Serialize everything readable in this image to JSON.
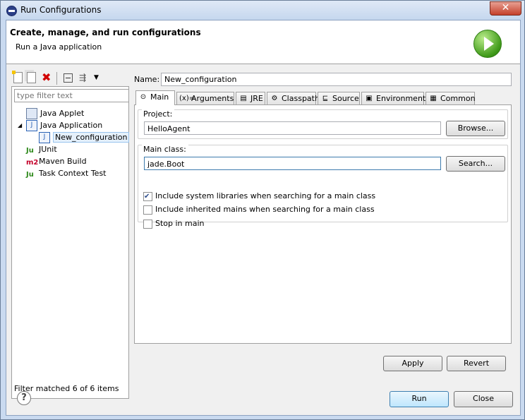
{
  "window": {
    "title": "Run Configurations",
    "close_glyph": "✕"
  },
  "header": {
    "title": "Create, manage, and run configurations",
    "subtitle": "Run a Java application"
  },
  "toolbar": {
    "delete_glyph": "✖",
    "filter_glyph": "⇶",
    "dropdown_glyph": "▼"
  },
  "filter": {
    "placeholder": "type filter text",
    "status": "Filter matched 6 of 6 items"
  },
  "tree": {
    "java_applet": {
      "label": "Java Applet"
    },
    "java_application": {
      "label": "Java Application",
      "expanded_glyph": "◢"
    },
    "new_configuration": {
      "label": "New_configuration"
    },
    "junit": {
      "label": "JUnit",
      "badge": "Ju"
    },
    "maven_build": {
      "label": "Maven Build",
      "badge": "m2"
    },
    "task_context_test": {
      "label": "Task Context Test",
      "badge": "Ju"
    }
  },
  "name": {
    "label": "Name:",
    "value": "New_configuration"
  },
  "tabs": {
    "main": {
      "label": "Main",
      "glyph": "⊙"
    },
    "arguments": {
      "label": "Arguments",
      "glyph": "(x)="
    },
    "jre": {
      "label": "JRE",
      "glyph": "▤"
    },
    "classpath": {
      "label": "Classpath",
      "glyph": "⚙"
    },
    "source": {
      "label": "Source",
      "glyph": "⊑"
    },
    "environment": {
      "label": "Environment",
      "glyph": "▣"
    },
    "common": {
      "label": "Common",
      "glyph": "▦"
    }
  },
  "main": {
    "project": {
      "label": "Project:",
      "value": "HelloAgent",
      "browse": "Browse..."
    },
    "main_class": {
      "label": "Main class:",
      "value": "jade.Boot",
      "search": "Search..."
    },
    "options": {
      "include_system": {
        "label": "Include system libraries when searching for a main class",
        "checked": true
      },
      "include_inherited": {
        "label": "Include inherited mains when searching for a main class",
        "checked": false
      },
      "stop_in_main": {
        "label": "Stop in main",
        "checked": false
      }
    }
  },
  "buttons": {
    "apply": "Apply",
    "revert": "Revert",
    "run": "Run",
    "close": "Close",
    "help_glyph": "?"
  },
  "colors": {
    "accent": "#3c7fb1",
    "run_green": "#3f9a19",
    "delete_red": "#d10000",
    "junit_green": "#2f8a1c",
    "maven_red": "#c4002a"
  }
}
